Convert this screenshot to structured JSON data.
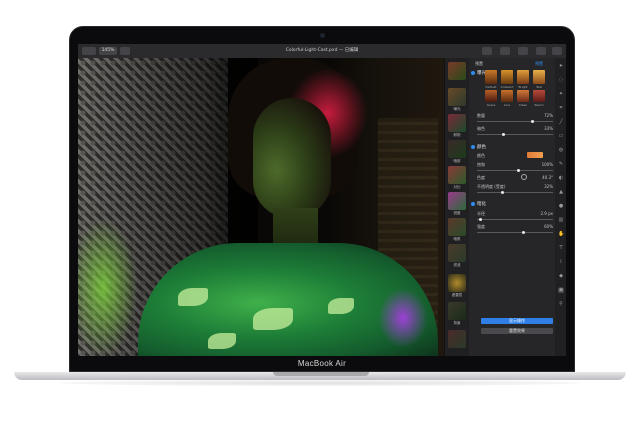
{
  "device": {
    "brand_label": "MacBook Air"
  },
  "titlebar": {
    "zoom": "145%",
    "document_title": "Colorful-Light-Cast.pxd — 已编辑"
  },
  "panel": {
    "layer_thumbs": [
      {
        "label": ""
      },
      {
        "label": "曝光"
      },
      {
        "label": "鲜艳"
      },
      {
        "label": "暗部"
      },
      {
        "label": "对比"
      },
      {
        "label": "锐度"
      },
      {
        "label": "暗角"
      },
      {
        "label": "滤波"
      },
      {
        "label": "遮罩层"
      },
      {
        "label": "背景"
      }
    ],
    "top_label": "预置",
    "top_dropdown": "预置",
    "section1": {
      "title": "曝光",
      "presets": [
        "Default",
        "Ambient",
        "Bright",
        "Teal"
      ],
      "presets2": [
        "Grass",
        "Line",
        "Clean",
        "Peach"
      ],
      "rows": [
        {
          "label": "数量",
          "value": "72%"
        },
        {
          "label": "暗色",
          "value": "33%"
        }
      ]
    },
    "section2": {
      "title": "颜色",
      "rows": [
        {
          "label": "颜色",
          "value": ""
        },
        {
          "label": "饱和",
          "value": "100%"
        },
        {
          "label": "色度",
          "value": "40.3°"
        },
        {
          "label": "不透明度 (受度)",
          "value": "32%"
        }
      ]
    },
    "section3": {
      "title": "暗化",
      "rows": [
        {
          "label": "半径",
          "value": "2.9 px"
        },
        {
          "label": "强度",
          "value": "60%"
        }
      ]
    },
    "apply_button": "显示操作",
    "reset_button": "重置效果"
  }
}
